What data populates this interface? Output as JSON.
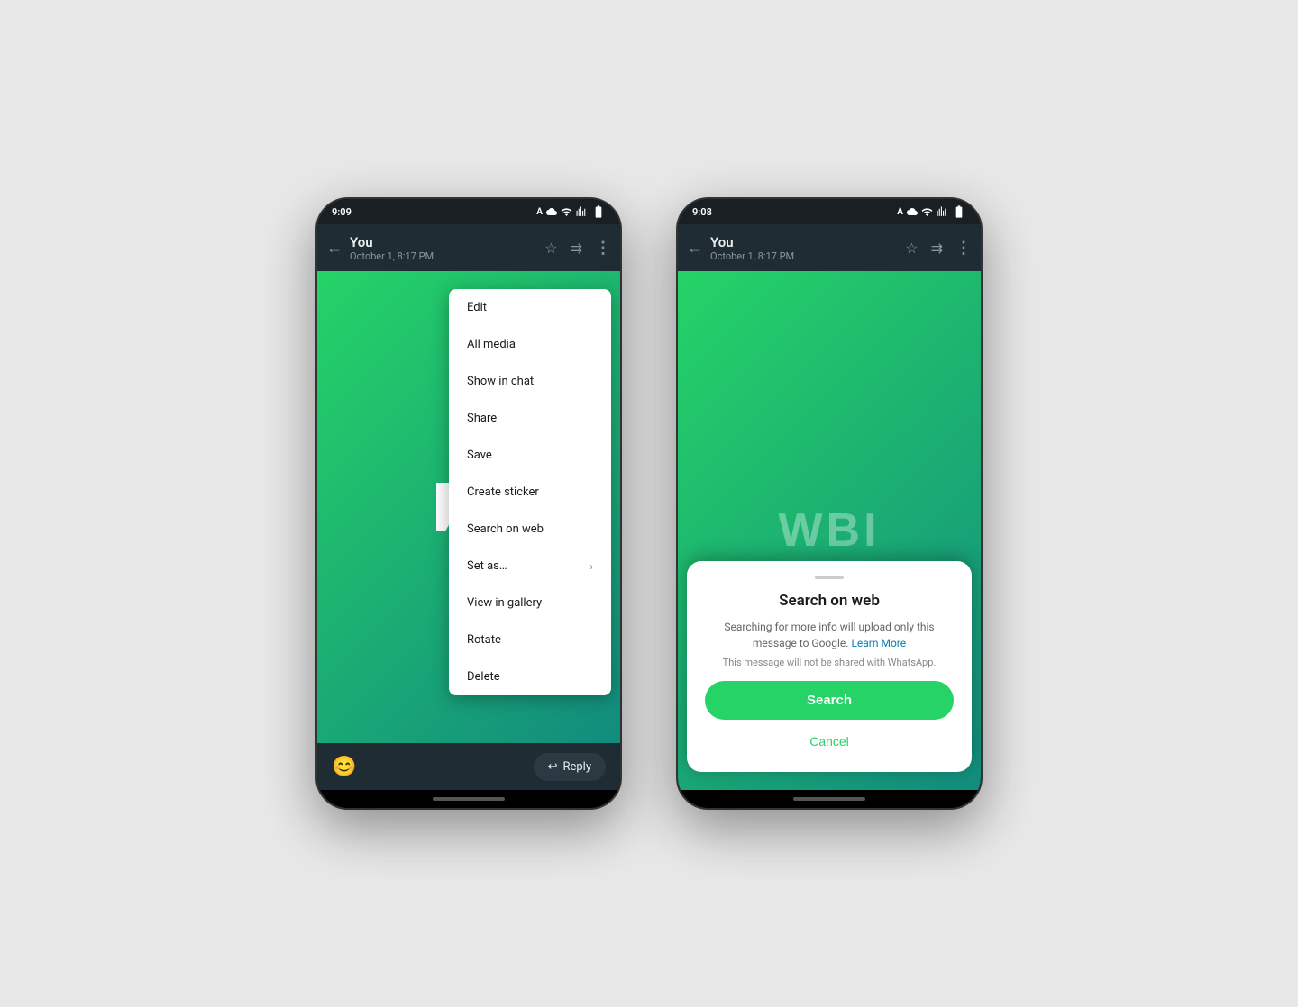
{
  "background": "#e8e8e8",
  "phone1": {
    "status_bar": {
      "time": "9:09",
      "icons": [
        "notification-a",
        "notification-cloud",
        "wifi",
        "signal",
        "battery"
      ]
    },
    "header": {
      "name": "You",
      "subtitle": "October 1, 8:17 PM",
      "icons": [
        "star",
        "forward",
        "more-vertical"
      ]
    },
    "context_menu": {
      "items": [
        {
          "label": "Edit",
          "has_arrow": false
        },
        {
          "label": "All media",
          "has_arrow": false
        },
        {
          "label": "Show in chat",
          "has_arrow": false
        },
        {
          "label": "Share",
          "has_arrow": false
        },
        {
          "label": "Save",
          "has_arrow": false
        },
        {
          "label": "Create sticker",
          "has_arrow": false
        },
        {
          "label": "Search on web",
          "has_arrow": false
        },
        {
          "label": "Set as…",
          "has_arrow": true
        },
        {
          "label": "View in gallery",
          "has_arrow": false
        },
        {
          "label": "Rotate",
          "has_arrow": false
        },
        {
          "label": "Delete",
          "has_arrow": false
        }
      ]
    },
    "bottom_bar": {
      "emoji_icon": "😊",
      "reply_label": "Reply"
    }
  },
  "phone2": {
    "status_bar": {
      "time": "9:08"
    },
    "header": {
      "name": "You",
      "subtitle": "October 1, 8:17 PM"
    },
    "wbi_logo_text": "WBI",
    "bottom_sheet": {
      "title": "Search on web",
      "description": "Searching for more info will upload only this message to Google.",
      "learn_more": "Learn More",
      "note": "This message will not be shared with WhatsApp.",
      "search_label": "Search",
      "cancel_label": "Cancel"
    }
  }
}
